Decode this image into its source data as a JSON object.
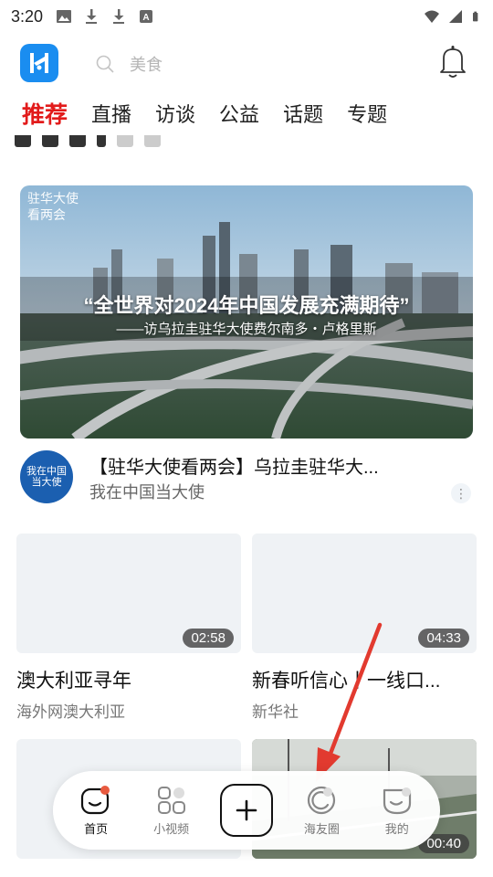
{
  "status_bar": {
    "time": "3:20",
    "left_icons": [
      "image-icon",
      "download-icon",
      "download-icon",
      "font-a-icon"
    ],
    "right_icons": [
      "wifi-icon",
      "signal-icon",
      "battery-icon"
    ]
  },
  "header": {
    "logo_icon": "app-logo-icon",
    "search_placeholder": "美食",
    "bell_icon": "bell-icon"
  },
  "tabs": [
    {
      "label": "推荐",
      "active": true
    },
    {
      "label": "直播",
      "active": false
    },
    {
      "label": "访谈",
      "active": false
    },
    {
      "label": "公益",
      "active": false
    },
    {
      "label": "话题",
      "active": false
    },
    {
      "label": "专题",
      "active": false
    }
  ],
  "feature": {
    "quote": "“全世界对2024年中国发展充满期待”",
    "subtitle": "——访乌拉圭驻华大使费尔南多・卢格里斯",
    "badge_line1": "驻华大使",
    "badge_line2": "看两会",
    "title": "【驻华大使看两会】乌拉圭驻华大...",
    "author": "我在中国当大使",
    "avatar_text_1": "我在中国",
    "avatar_text_2": "当大使"
  },
  "cards": [
    {
      "duration": "02:58",
      "title": "澳大利亚寻年",
      "source": "海外网澳大利亚"
    },
    {
      "duration": "04:33",
      "title": "新春听信心丨一线口...",
      "source": "新华社"
    },
    {
      "duration": "",
      "title": "",
      "source": ""
    },
    {
      "duration": "00:40",
      "title": "",
      "source": ""
    }
  ],
  "bottom_nav": [
    {
      "label": "首页",
      "icon": "home-face-icon",
      "active": true
    },
    {
      "label": "小视频",
      "icon": "grid-icon",
      "active": false
    },
    {
      "label": "",
      "icon": "plus-icon",
      "active": false
    },
    {
      "label": "海友圈",
      "icon": "circle-icon",
      "active": false
    },
    {
      "label": "我的",
      "icon": "profile-face-icon",
      "active": false
    }
  ],
  "colors": {
    "accent": "#e21b1b",
    "logo": "#1a8df0",
    "arrow": "#e23a2f"
  }
}
